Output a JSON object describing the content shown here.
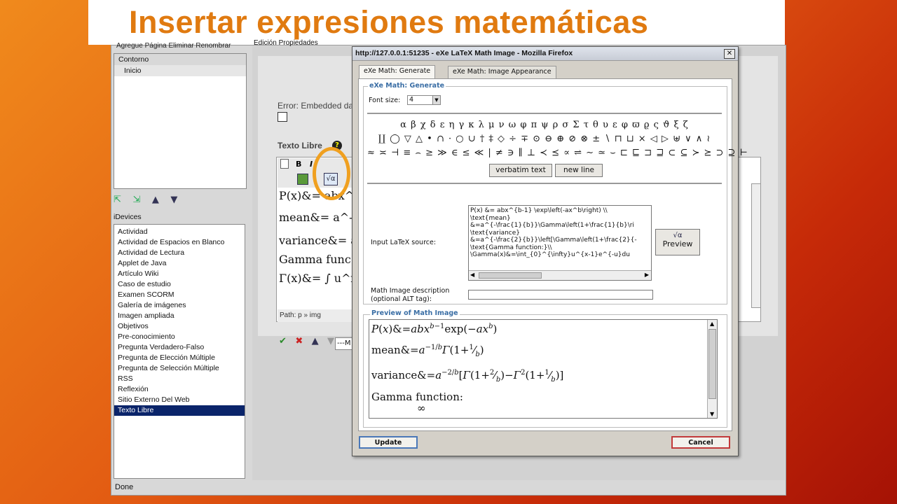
{
  "slide": {
    "title": "Insertar expresiones matemáticas"
  },
  "app": {
    "top_menu": "Agregue Página   Eliminar   Renombrar",
    "tab_edit": "Edición   Propiedades",
    "outline": {
      "items": [
        "Contorno",
        "Inicio"
      ]
    },
    "idevices_header": "iDevices",
    "idevices": [
      "Actividad",
      "Actividad de Espacios en Blanco",
      "Actividad de Lectura",
      "Applet de Java",
      "Artículo Wiki",
      "Caso de estudio",
      "Examen SCORM",
      "Galería de imágenes",
      "Imagen ampliada",
      "Objetivos",
      "Pre-conocimiento",
      "Pregunta Verdadero-Falso",
      "Pregunta de Elección Múltiple",
      "Pregunta de Selección Múltiple",
      "RSS",
      "Reflexión",
      "Sitio Externo Del Web",
      "Texto Libre"
    ],
    "selected_idevice": "Texto Libre",
    "error_text": "Error: Embedded da",
    "texto_libre_label": "Texto Libre",
    "editor_math": [
      "P(x)&= abx^b-",
      "mean&= a^-1/b",
      "variance&= a",
      "Gamma func",
      "Γ(x)&= ∫ u^x-"
    ],
    "path_bar": "Path: p » img",
    "select_small": "---M",
    "status": "Done"
  },
  "popup": {
    "title": "http://127.0.0.1:51235 - eXe LaTeX Math Image - Mozilla Firefox",
    "close_label": "✕",
    "tabs": [
      "eXe Math: Generate",
      "eXe Math: Image Appearance"
    ],
    "generate_legend": "eXe Math: Generate",
    "font_size_label": "Font size:",
    "font_size_value": "4",
    "symbol_rows": [
      "α β χ δ ε η γ κ λ μ ν ω φ π ψ ρ σ Σ τ θ υ ε φ ϖ ϱ ς ϑ ξ ζ",
      "∐ ◯ ▽ △ • ∩ · ○ ∪ † ‡ ◇ ÷ ∓ ⊙ ⊖ ⊕ ⊘ ⊗ ± ∖ ⊓ ⊔ × ◁ ▷ ⊎ ∨ ∧ ≀",
      "≈ ≍ ⊣ ≡ ⌢ ≥ ≫ ∈ ≤ ≪ | ≠ ∋ ∥ ⊥ ≺ ⪯ ∝ ⇌ ∼ ≃ ⌣ ⊏ ⊑ ⊐ ⊒ ⊂ ⊆ ≻ ⪰ ⊃ ⊇ ⊢"
    ],
    "verbatim_label": "verbatim text",
    "newline_label": "new line",
    "input_label": "Input LaTeX source:",
    "latex_lines": [
      "P(x) &= abx^{b-1} \\exp\\left(-ax^b\\right) \\\\",
      "\\text{mean}",
      "&=a^{-\\frac{1}{b}}\\Gamma\\left(1+\\frac{1}{b}\\ri",
      "\\text{variance}",
      "&=a^{-\\frac{2}{b}}\\left[\\Gamma\\left(1+\\frac{2}{-",
      "\\text{Gamma function:}\\\\",
      "\\Gamma(x)&=\\int_{0}^{\\infty}u^{x-1}e^{-u}du"
    ],
    "preview_label": "Preview",
    "desc_label_1": "Math Image description",
    "desc_label_2": "(optional ALT tag):",
    "desc_value": "",
    "preview_legend": "Preview of Math Image",
    "update_label": "Update",
    "cancel_label": "Cancel"
  },
  "colors": {
    "title_orange": "#e07a10",
    "highlight_ring": "#f0a020",
    "legend_blue": "#3a6ea5",
    "selected_bg": "#0a246a"
  }
}
